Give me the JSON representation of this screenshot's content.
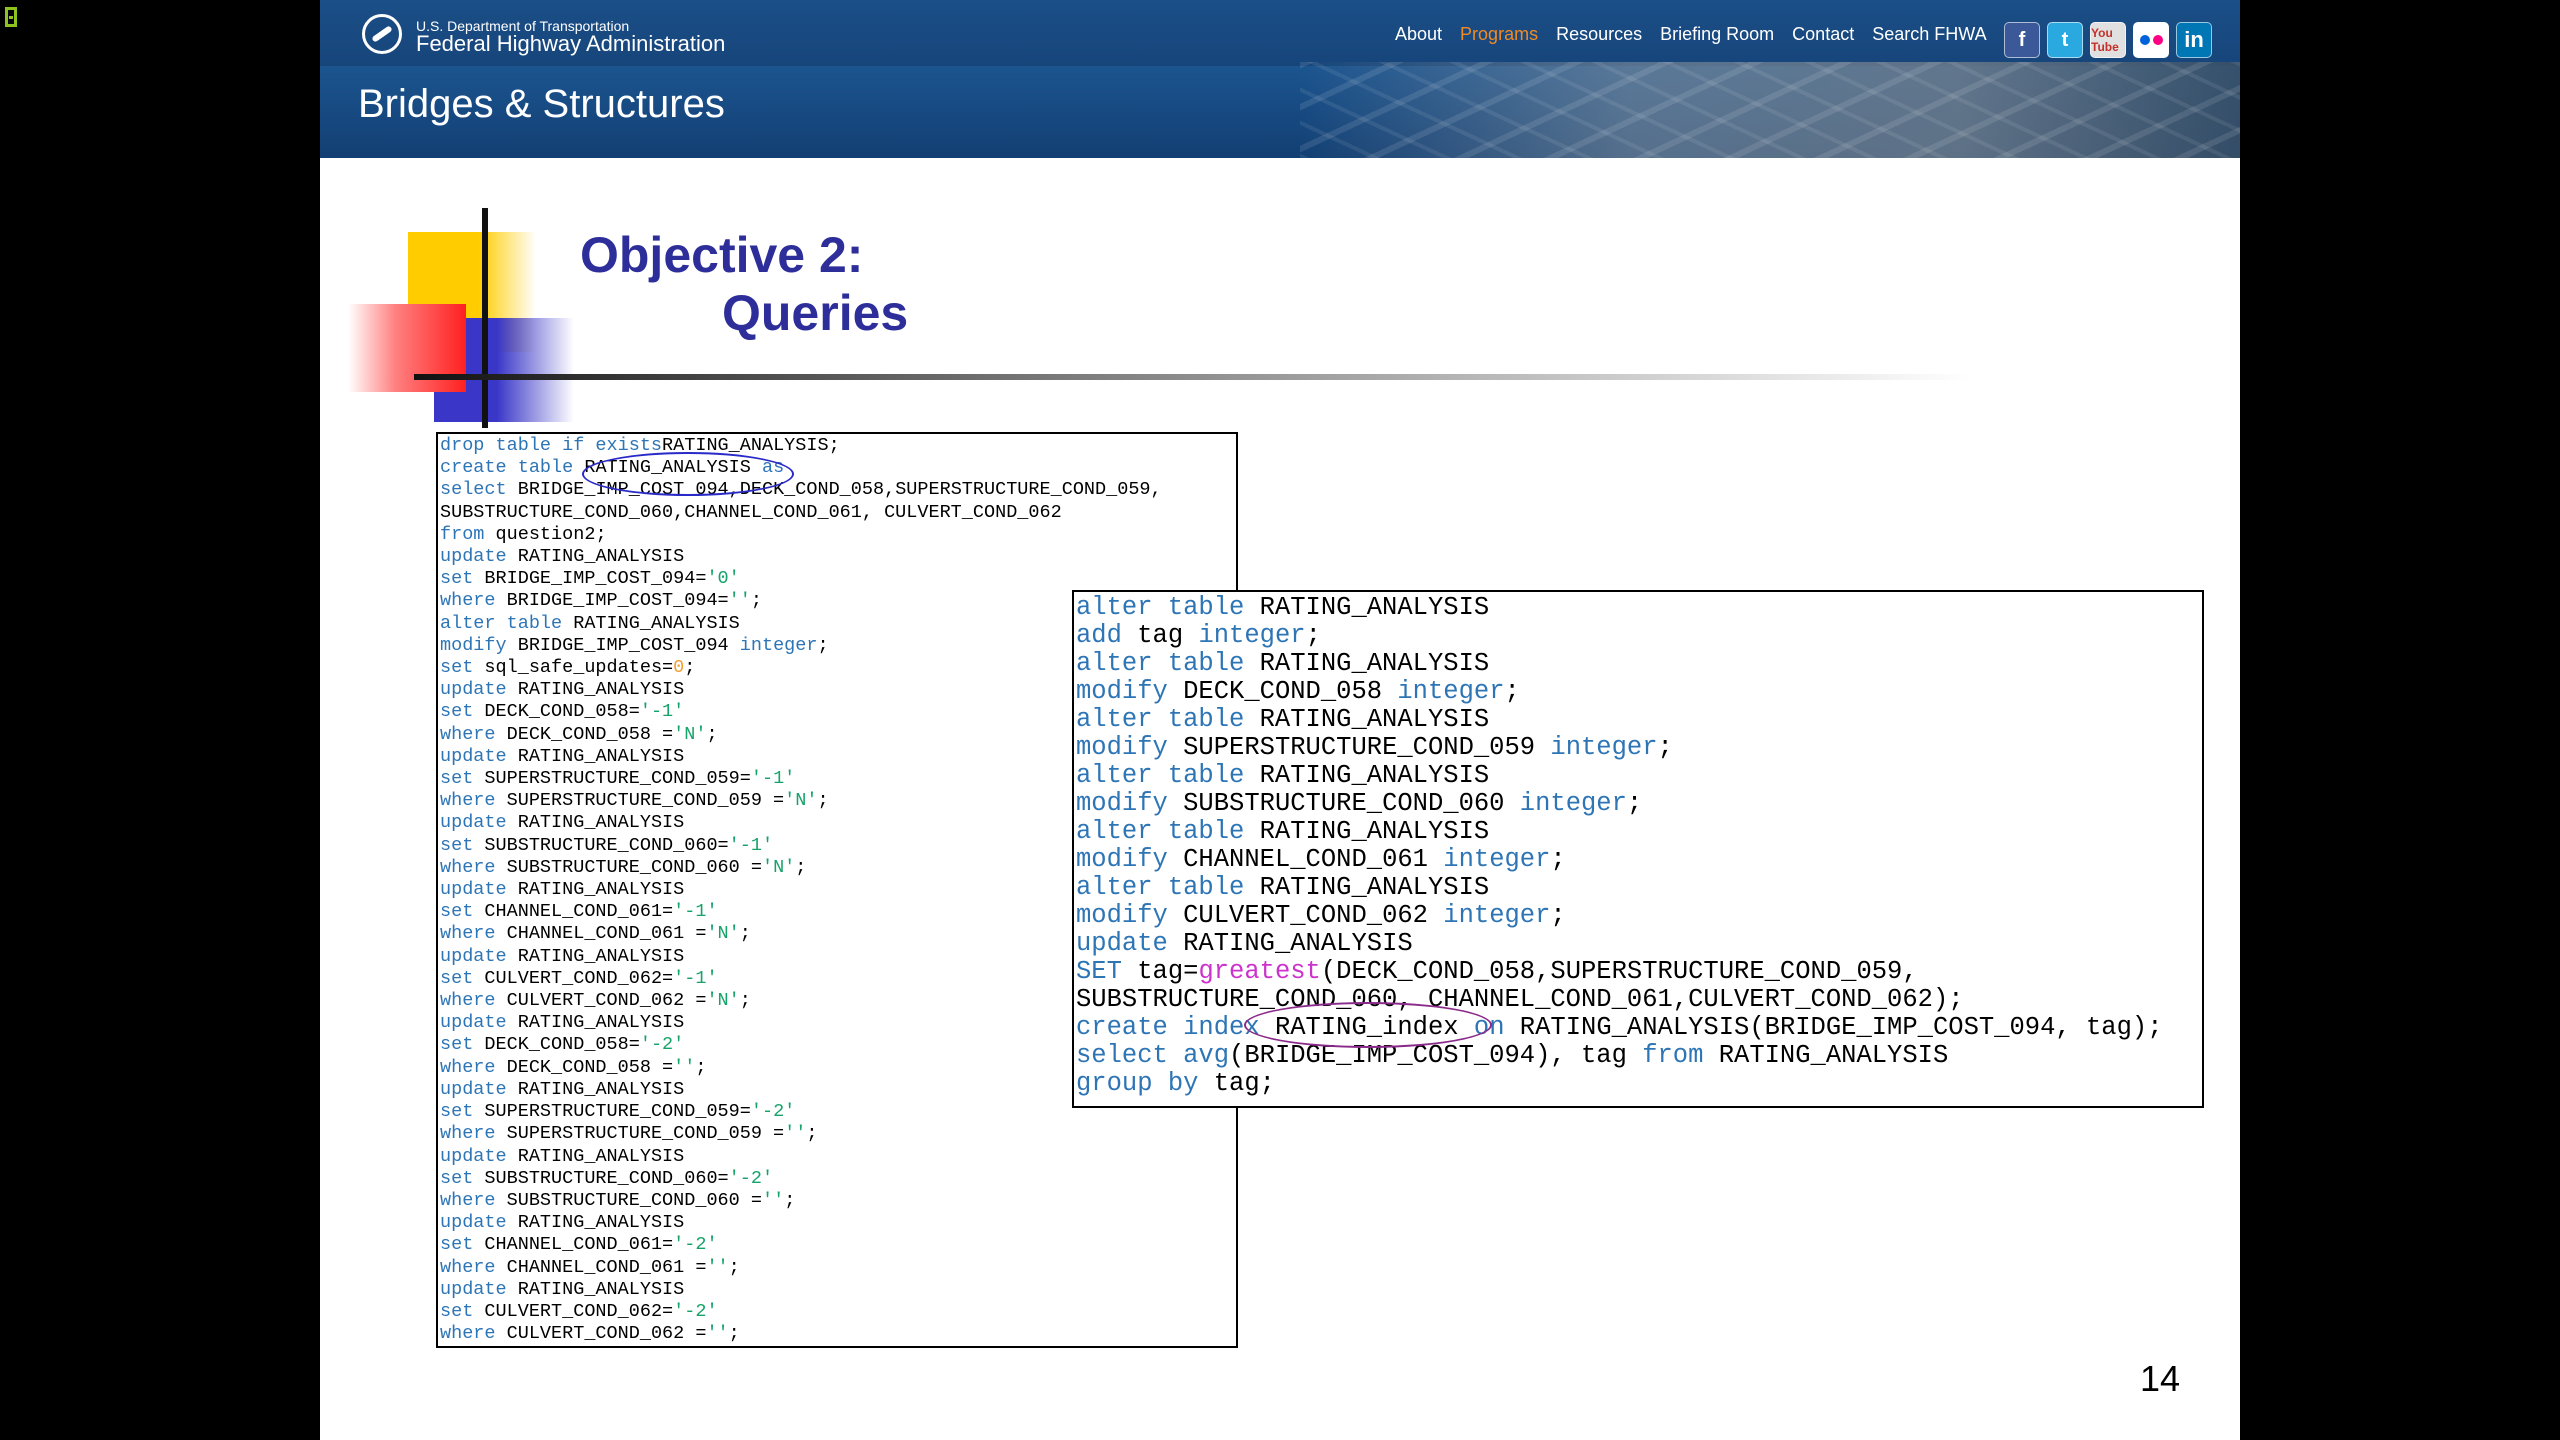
{
  "agency": {
    "department": "U.S. Department of Transportation",
    "name": "Federal Highway Administration"
  },
  "nav": [
    "About",
    "Programs",
    "Resources",
    "Briefing Room",
    "Contact",
    "Search FHWA"
  ],
  "nav_active": "Programs",
  "social": {
    "facebook": "f",
    "twitter": "t",
    "youtube": "You Tube",
    "linkedin": "in"
  },
  "site_title": "Bridges & Structures",
  "slide": {
    "title_line1": "Objective 2:",
    "title_line2": "Queries",
    "page_number": "14"
  },
  "code_left": [
    [
      [
        "k",
        "drop table if exists"
      ],
      [
        "",
        "RATING_ANALYSIS;"
      ]
    ],
    [
      [
        "k",
        "create table"
      ],
      [
        "",
        " RATING_ANALYSIS "
      ],
      [
        "k",
        "as"
      ]
    ],
    [
      [
        "k",
        "select"
      ],
      [
        "",
        " BRIDGE_IMP_COST_094,DECK_COND_058,SUPERSTRUCTURE_COND_059,"
      ]
    ],
    [
      [
        "",
        "SUBSTRUCTURE_COND_060,CHANNEL_COND_061, CULVERT_COND_062"
      ]
    ],
    [
      [
        "k",
        "from"
      ],
      [
        "",
        " question2;"
      ]
    ],
    [
      [
        "k",
        "update"
      ],
      [
        "",
        " RATING_ANALYSIS"
      ]
    ],
    [
      [
        "k",
        "set"
      ],
      [
        "",
        " BRIDGE_IMP_COST_094="
      ],
      [
        "s",
        "'0'"
      ]
    ],
    [
      [
        "k",
        "where"
      ],
      [
        "",
        " BRIDGE_IMP_COST_094="
      ],
      [
        "s",
        "''"
      ],
      [
        "",
        ";"
      ]
    ],
    [
      [
        "k",
        "alter table"
      ],
      [
        "",
        " RATING_ANALYSIS"
      ]
    ],
    [
      [
        "k",
        "modify"
      ],
      [
        "",
        " BRIDGE_IMP_COST_094 "
      ],
      [
        "k",
        "integer"
      ],
      [
        "",
        ";"
      ]
    ],
    [
      [
        "k",
        "set"
      ],
      [
        "",
        " sql_safe_updates="
      ],
      [
        "n",
        "0"
      ],
      [
        "",
        ";"
      ]
    ],
    [
      [
        "k",
        "update"
      ],
      [
        "",
        " RATING_ANALYSIS"
      ]
    ],
    [
      [
        "k",
        "set"
      ],
      [
        "",
        " DECK_COND_058="
      ],
      [
        "s",
        "'-1'"
      ]
    ],
    [
      [
        "k",
        "where"
      ],
      [
        "",
        " DECK_COND_058 ="
      ],
      [
        "s",
        "'N'"
      ],
      [
        "",
        ";"
      ]
    ],
    [
      [
        "k",
        "update"
      ],
      [
        "",
        " RATING_ANALYSIS"
      ]
    ],
    [
      [
        "k",
        "set"
      ],
      [
        "",
        " SUPERSTRUCTURE_COND_059="
      ],
      [
        "s",
        "'-1'"
      ]
    ],
    [
      [
        "k",
        "where"
      ],
      [
        "",
        " SUPERSTRUCTURE_COND_059 ="
      ],
      [
        "s",
        "'N'"
      ],
      [
        "",
        ";"
      ]
    ],
    [
      [
        "k",
        "update"
      ],
      [
        "",
        " RATING_ANALYSIS"
      ]
    ],
    [
      [
        "k",
        "set"
      ],
      [
        "",
        " SUBSTRUCTURE_COND_060="
      ],
      [
        "s",
        "'-1'"
      ]
    ],
    [
      [
        "k",
        "where"
      ],
      [
        "",
        " SUBSTRUCTURE_COND_060 ="
      ],
      [
        "s",
        "'N'"
      ],
      [
        "",
        ";"
      ]
    ],
    [
      [
        "k",
        "update"
      ],
      [
        "",
        " RATING_ANALYSIS"
      ]
    ],
    [
      [
        "k",
        "set"
      ],
      [
        "",
        " CHANNEL_COND_061="
      ],
      [
        "s",
        "'-1'"
      ]
    ],
    [
      [
        "k",
        "where"
      ],
      [
        "",
        " CHANNEL_COND_061 ="
      ],
      [
        "s",
        "'N'"
      ],
      [
        "",
        ";"
      ]
    ],
    [
      [
        "k",
        "update"
      ],
      [
        "",
        " RATING_ANALYSIS"
      ]
    ],
    [
      [
        "k",
        "set"
      ],
      [
        "",
        " CULVERT_COND_062="
      ],
      [
        "s",
        "'-1'"
      ]
    ],
    [
      [
        "k",
        "where"
      ],
      [
        "",
        " CULVERT_COND_062 ="
      ],
      [
        "s",
        "'N'"
      ],
      [
        "",
        ";"
      ]
    ],
    [
      [
        "k",
        "update"
      ],
      [
        "",
        " RATING_ANALYSIS"
      ]
    ],
    [
      [
        "k",
        "set"
      ],
      [
        "",
        " DECK_COND_058="
      ],
      [
        "s",
        "'-2'"
      ]
    ],
    [
      [
        "k",
        "where"
      ],
      [
        "",
        " DECK_COND_058 ="
      ],
      [
        "s",
        "''"
      ],
      [
        "",
        ";"
      ]
    ],
    [
      [
        "k",
        "update"
      ],
      [
        "",
        " RATING_ANALYSIS"
      ]
    ],
    [
      [
        "k",
        "set"
      ],
      [
        "",
        " SUPERSTRUCTURE_COND_059="
      ],
      [
        "s",
        "'-2'"
      ]
    ],
    [
      [
        "k",
        "where"
      ],
      [
        "",
        " SUPERSTRUCTURE_COND_059 ="
      ],
      [
        "s",
        "''"
      ],
      [
        "",
        ";"
      ]
    ],
    [
      [
        "k",
        "update"
      ],
      [
        "",
        " RATING_ANALYSIS"
      ]
    ],
    [
      [
        "k",
        "set"
      ],
      [
        "",
        " SUBSTRUCTURE_COND_060="
      ],
      [
        "s",
        "'-2'"
      ]
    ],
    [
      [
        "k",
        "where"
      ],
      [
        "",
        " SUBSTRUCTURE_COND_060 ="
      ],
      [
        "s",
        "''"
      ],
      [
        "",
        ";"
      ]
    ],
    [
      [
        "k",
        "update"
      ],
      [
        "",
        " RATING_ANALYSIS"
      ]
    ],
    [
      [
        "k",
        "set"
      ],
      [
        "",
        " CHANNEL_COND_061="
      ],
      [
        "s",
        "'-2'"
      ]
    ],
    [
      [
        "k",
        "where"
      ],
      [
        "",
        " CHANNEL_COND_061 ="
      ],
      [
        "s",
        "''"
      ],
      [
        "",
        ";"
      ]
    ],
    [
      [
        "k",
        "update"
      ],
      [
        "",
        " RATING_ANALYSIS"
      ]
    ],
    [
      [
        "k",
        "set"
      ],
      [
        "",
        " CULVERT_COND_062="
      ],
      [
        "s",
        "'-2'"
      ]
    ],
    [
      [
        "k",
        "where"
      ],
      [
        "",
        " CULVERT_COND_062 ="
      ],
      [
        "s",
        "''"
      ],
      [
        "",
        ";"
      ]
    ]
  ],
  "code_right": [
    [
      [
        "k",
        "alter table"
      ],
      [
        "",
        " RATING_ANALYSIS"
      ]
    ],
    [
      [
        "k",
        "add"
      ],
      [
        "",
        " tag "
      ],
      [
        "k",
        "integer"
      ],
      [
        "",
        ";"
      ]
    ],
    [
      [
        "k",
        "alter table"
      ],
      [
        "",
        " RATING_ANALYSIS"
      ]
    ],
    [
      [
        "k",
        "modify"
      ],
      [
        "",
        " DECK_COND_058 "
      ],
      [
        "k",
        "integer"
      ],
      [
        "",
        ";"
      ]
    ],
    [
      [
        "k",
        "alter table"
      ],
      [
        "",
        " RATING_ANALYSIS"
      ]
    ],
    [
      [
        "k",
        "modify"
      ],
      [
        "",
        " SUPERSTRUCTURE_COND_059 "
      ],
      [
        "k",
        "integer"
      ],
      [
        "",
        ";"
      ]
    ],
    [
      [
        "k",
        "alter table"
      ],
      [
        "",
        " RATING_ANALYSIS"
      ]
    ],
    [
      [
        "k",
        "modify"
      ],
      [
        "",
        " SUBSTRUCTURE_COND_060 "
      ],
      [
        "k",
        "integer"
      ],
      [
        "",
        ";"
      ]
    ],
    [
      [
        "k",
        "alter table"
      ],
      [
        "",
        " RATING_ANALYSIS"
      ]
    ],
    [
      [
        "k",
        "modify"
      ],
      [
        "",
        " CHANNEL_COND_061 "
      ],
      [
        "k",
        "integer"
      ],
      [
        "",
        ";"
      ]
    ],
    [
      [
        "k",
        "alter table"
      ],
      [
        "",
        " RATING_ANALYSIS"
      ]
    ],
    [
      [
        "k",
        "modify"
      ],
      [
        "",
        " CULVERT_COND_062 "
      ],
      [
        "k",
        "integer"
      ],
      [
        "",
        ";"
      ]
    ],
    [
      [
        "k",
        "update"
      ],
      [
        "",
        " RATING_ANALYSIS"
      ]
    ],
    [
      [
        "k",
        "SET"
      ],
      [
        "",
        " tag="
      ],
      [
        "f",
        "greatest"
      ],
      [
        "",
        "(DECK_COND_058,SUPERSTRUCTURE_COND_059,"
      ]
    ],
    [
      [
        "",
        "SUBSTRUCTURE_COND_060, CHANNEL_COND_061,CULVERT_COND_062);"
      ]
    ],
    [
      [
        "k",
        "create index"
      ],
      [
        "",
        " RATING_index "
      ],
      [
        "k",
        "on"
      ],
      [
        "",
        " RATING_ANALYSIS(BRIDGE_IMP_COST_094, tag);"
      ]
    ],
    [
      [
        "k",
        "select avg"
      ],
      [
        "",
        "(BRIDGE_IMP_COST_094), tag "
      ],
      [
        "k",
        "from"
      ],
      [
        "",
        " RATING_ANALYSIS"
      ]
    ],
    [
      [
        "k",
        "group by"
      ],
      [
        "",
        " tag;"
      ]
    ]
  ]
}
